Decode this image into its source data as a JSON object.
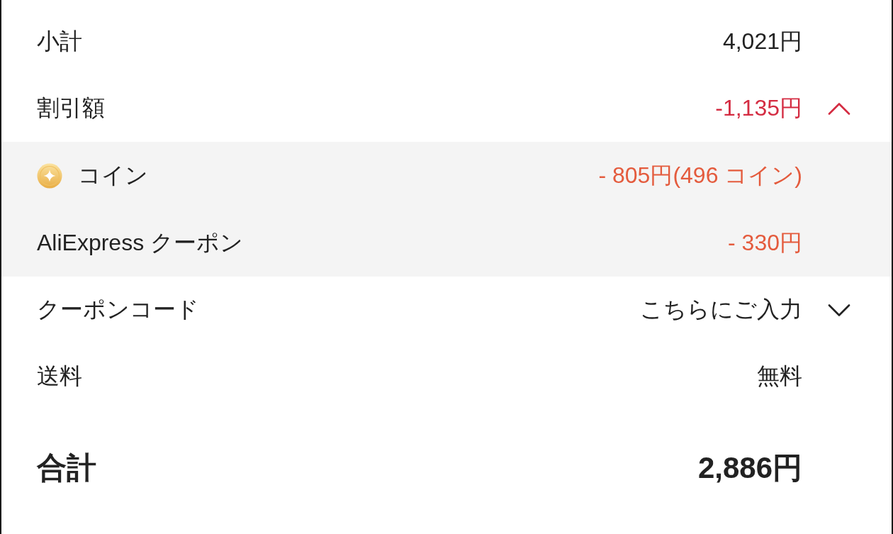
{
  "rows": [
    {
      "kind": "line",
      "label": "小計",
      "value": "4,021円"
    },
    {
      "kind": "discount",
      "label": "割引額",
      "value": "-1,135円",
      "expanded": true,
      "children": [
        {
          "kind": "coin",
          "label": "コイン",
          "value": "- 805円(496 コイン)"
        },
        {
          "kind": "coupon",
          "label": "AliExpress クーポン",
          "value": "- 330円"
        }
      ]
    },
    {
      "kind": "code",
      "label": "クーポンコード",
      "value": "こちらにご入力",
      "expanded": false
    },
    {
      "kind": "line",
      "label": "送料",
      "value": "無料"
    },
    {
      "kind": "total",
      "label": "合計",
      "value": "2,886円"
    }
  ]
}
